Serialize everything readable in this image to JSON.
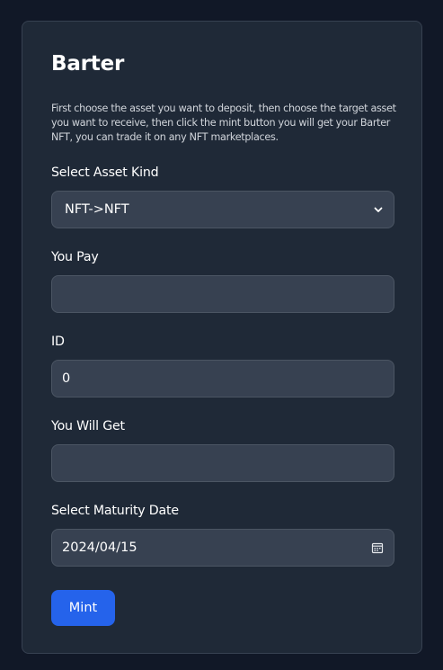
{
  "form": {
    "title": "Barter",
    "description": "First choose the asset you want to deposit, then choose the target asset you want to receive, then click the mint button you will get your Barter NFT, you can trade it on any NFT marketplaces.",
    "asset_kind": {
      "label": "Select Asset Kind",
      "selected": "NFT->NFT",
      "icon": "chevron-down-icon"
    },
    "you_pay": {
      "label": "You Pay",
      "value": ""
    },
    "id": {
      "label": "ID",
      "value": "0"
    },
    "you_will_get": {
      "label": "You Will Get",
      "value": ""
    },
    "maturity_date": {
      "label": "Select Maturity Date",
      "value": "2024/04/15",
      "icon": "calendar-icon"
    },
    "mint_label": "Mint"
  },
  "colors": {
    "page_bg": "#111827",
    "card_bg": "#1f2937",
    "field_bg": "#374151",
    "accent": "#2563eb"
  }
}
